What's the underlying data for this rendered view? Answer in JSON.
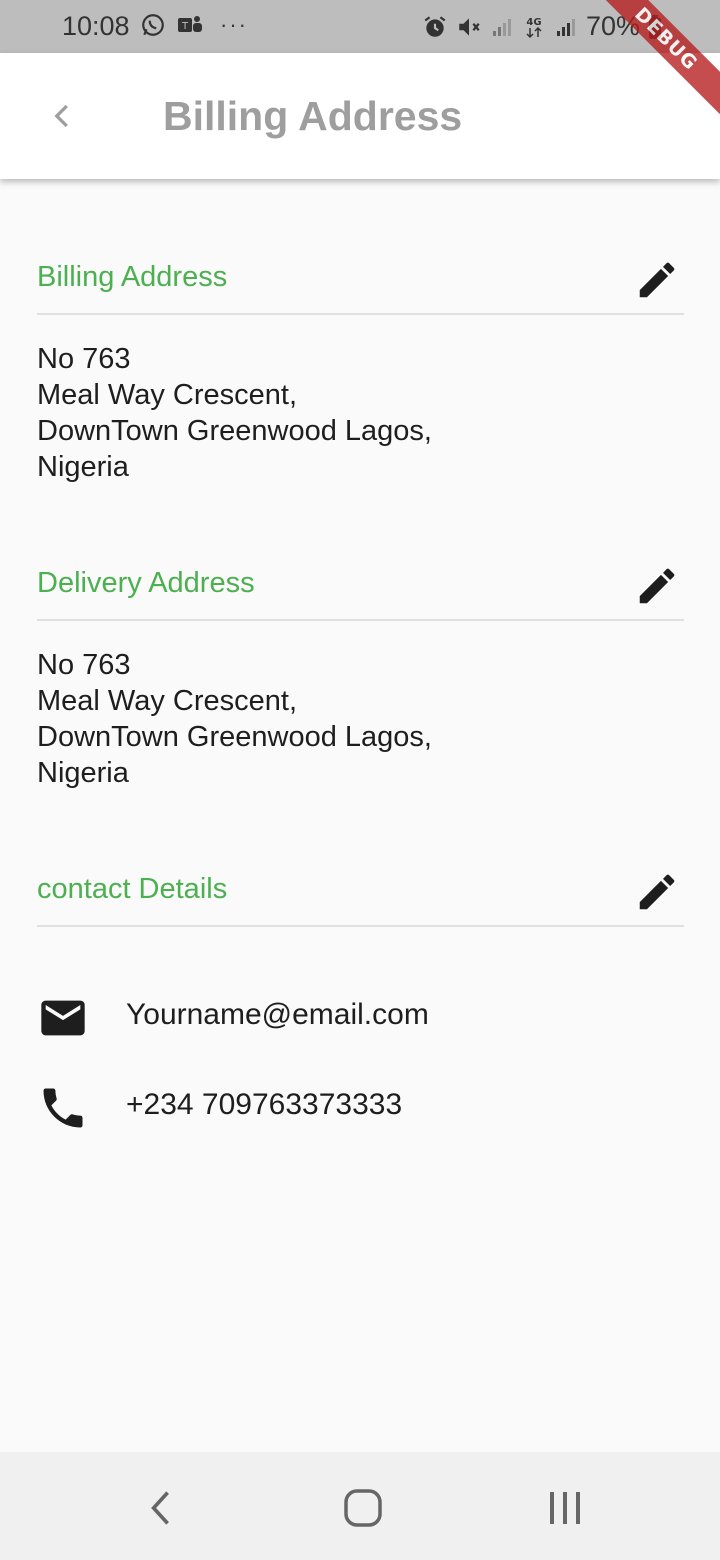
{
  "status_bar": {
    "time": "10:08",
    "battery": "70%",
    "network": "4G"
  },
  "debug_banner": "DEBUG",
  "app_bar": {
    "title": "Billing Address",
    "back_icon": "chevron-left-icon"
  },
  "billing": {
    "title": "Billing Address",
    "edit_icon": "pencil-icon",
    "lines": [
      "No 763",
      "Meal Way Crescent,",
      "DownTown Greenwood Lagos,",
      "Nigeria"
    ]
  },
  "delivery": {
    "title": "Delivery Address",
    "edit_icon": "pencil-icon",
    "lines": [
      "No 763",
      "Meal Way Crescent,",
      "DownTown Greenwood Lagos,",
      "Nigeria"
    ]
  },
  "contact": {
    "title": "contact Details",
    "edit_icon": "pencil-icon",
    "email": "Yourname@email.com",
    "phone": "+234 709763373333"
  },
  "colors": {
    "accent": "#4caf50",
    "title_gray": "#9e9e9e",
    "text": "#1e1e1e",
    "background": "#fafafa"
  }
}
